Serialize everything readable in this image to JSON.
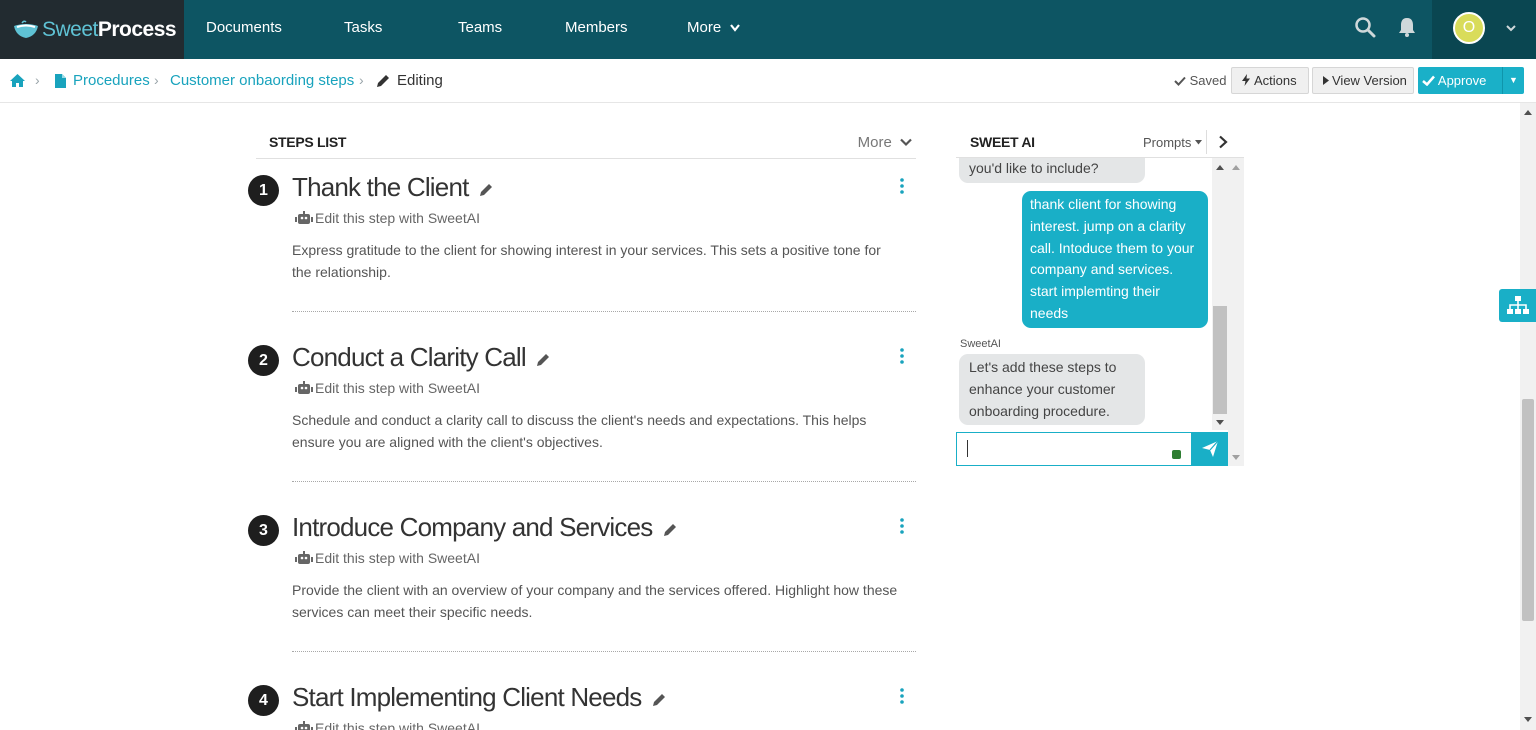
{
  "app": {
    "logo_light": "Sweet",
    "logo_bold": "Process"
  },
  "nav": {
    "items": [
      "Documents",
      "Tasks",
      "Teams",
      "Members",
      "More"
    ]
  },
  "user": {
    "initial": "O"
  },
  "breadcrumb": {
    "procedures": "Procedures",
    "procedure": "Customer onbaording steps",
    "current": "Editing"
  },
  "toolbar": {
    "saved": "Saved",
    "actions": "Actions",
    "view_version": "View Version",
    "approve": "Approve"
  },
  "steps_list": {
    "title": "STEPS LIST",
    "more": "More",
    "edit_with_ai": "Edit this step with SweetAI",
    "steps": [
      {
        "number": "1",
        "title": "Thank the Client",
        "description": "Express gratitude to the client for showing interest in your services. This sets a positive tone for the relationship."
      },
      {
        "number": "2",
        "title": "Conduct a Clarity Call",
        "description": "Schedule and conduct a clarity call to discuss the client's needs and expectations. This helps ensure you are aligned with the client's objectives."
      },
      {
        "number": "3",
        "title": "Introduce Company and Services",
        "description": "Provide the client with an overview of your company and the services offered. Highlight how these services can meet their specific needs."
      },
      {
        "number": "4",
        "title": "Start Implementing Client Needs",
        "description": ""
      }
    ]
  },
  "sweet_ai": {
    "title": "SWEET AI",
    "prompts": "Prompts",
    "messages": {
      "ai_partial": "you'd like to include?",
      "user": "thank client for showing interest. jump on a clarity call. Intoduce them to your company and services. start implemting their needs",
      "sender": "SweetAI",
      "ai_reply": "Let's add these steps to enhance your customer onboarding procedure."
    },
    "input_value": ""
  },
  "colors": {
    "nav_bg": "#0d5563",
    "logo_bg": "#222b30",
    "accent": "#19afc7",
    "link": "#19a3bd"
  }
}
